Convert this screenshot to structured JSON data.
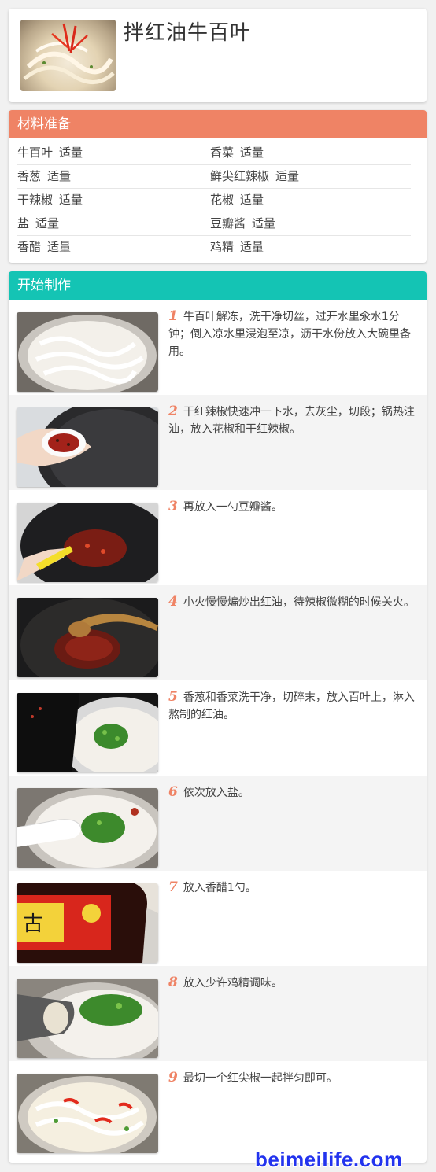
{
  "recipe": {
    "title": "拌红油牛百叶"
  },
  "ingredients": {
    "header": "材料准备",
    "rows": [
      [
        {
          "name": "牛百叶",
          "amount": "适量"
        },
        {
          "name": "香菜",
          "amount": "适量"
        }
      ],
      [
        {
          "name": "香葱",
          "amount": "适量"
        },
        {
          "name": "鲜尖红辣椒",
          "amount": "适量"
        }
      ],
      [
        {
          "name": "干辣椒",
          "amount": "适量"
        },
        {
          "name": "花椒",
          "amount": "适量"
        }
      ],
      [
        {
          "name": "盐",
          "amount": "适量"
        },
        {
          "name": "豆瓣酱",
          "amount": "适量"
        }
      ],
      [
        {
          "name": "香醋",
          "amount": "适量"
        },
        {
          "name": "鸡精",
          "amount": "适量"
        }
      ]
    ]
  },
  "steps": {
    "header": "开始制作",
    "items": [
      {
        "num": "1",
        "text": "牛百叶解冻，洗干净切丝，过开水里汆水1分钟；倒入凉水里浸泡至凉，沥干水份放入大碗里备用。"
      },
      {
        "num": "2",
        "text": "干红辣椒快速冲一下水，去灰尘，切段；锅热注油，放入花椒和干红辣椒。"
      },
      {
        "num": "3",
        "text": "再放入一勺豆瓣酱。"
      },
      {
        "num": "4",
        "text": "小火慢慢煸炒出红油，待辣椒微糊的时候关火。"
      },
      {
        "num": "5",
        "text": "香葱和香菜洗干净，切碎末，放入百叶上，淋入熬制的红油。"
      },
      {
        "num": "6",
        "text": "依次放入盐。"
      },
      {
        "num": "7",
        "text": "放入香醋1勺。"
      },
      {
        "num": "8",
        "text": "放入少许鸡精调味。"
      },
      {
        "num": "9",
        "text": "最切一个红尖椒一起拌匀即可。"
      }
    ]
  },
  "watermark": "beimeilife.com",
  "colors": {
    "ingredients_header": "#ef8365",
    "steps_header": "#14c4b4",
    "step_number": "#ef8365",
    "watermark": "#2233ee"
  }
}
